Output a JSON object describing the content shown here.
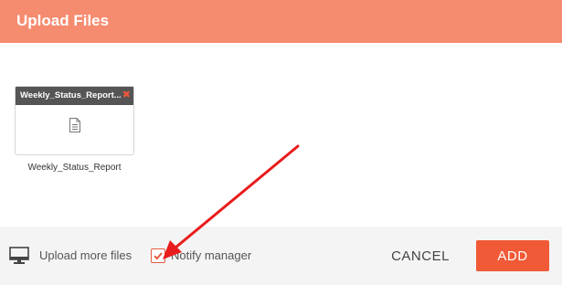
{
  "dialog": {
    "title": "Upload Files"
  },
  "files": [
    {
      "name": "Weekly_Status_Report...",
      "caption": "Weekly_Status_Report",
      "remove_icon": "close-icon",
      "type_icon": "document-icon"
    }
  ],
  "footer": {
    "upload_more_icon": "monitor-icon",
    "upload_more_label": "Upload more files",
    "notify_manager_label": "Notify manager",
    "notify_manager_checked": true,
    "cancel_label": "CANCEL",
    "add_label": "ADD"
  },
  "colors": {
    "header_bg": "#f58b6f",
    "accent": "#f05a36",
    "footer_bg": "#f4f4f4",
    "annotation_arrow": "#e81c1c"
  }
}
